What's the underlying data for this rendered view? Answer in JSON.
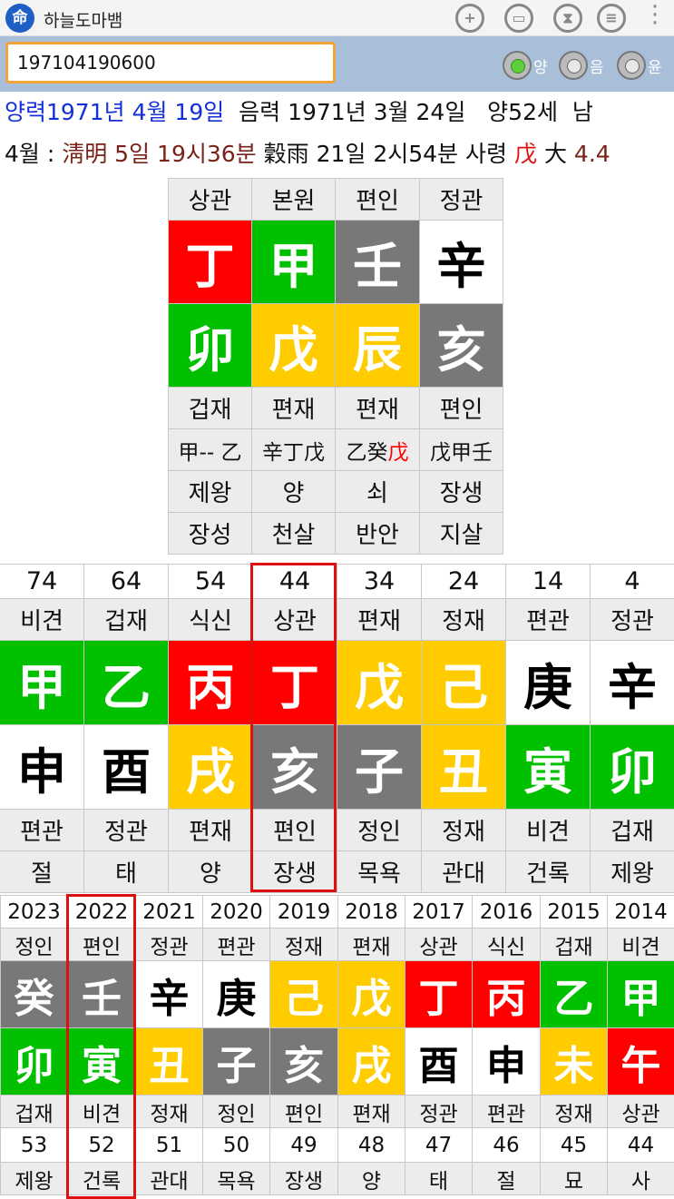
{
  "app": {
    "title": "하늘도마뱀",
    "icon_glyph": "命"
  },
  "toolbar": {
    "icons": [
      "add-person-icon",
      "save-icon",
      "hourglass-icon",
      "database-icon"
    ],
    "menu_icon": "more-vert-icon"
  },
  "input": {
    "value": "197104190600"
  },
  "gender": {
    "options": [
      "양",
      "음",
      "윤"
    ],
    "selected": "양"
  },
  "info": {
    "solar": "양력1971년 4월 19일",
    "lunar": "음력 1971년 3월 24일",
    "age": "양52세",
    "sex": "남",
    "month": "4월 :",
    "term1": "淸明 5일 19시36분",
    "term2": "穀雨 21일 2시54분",
    "saryeong_label": "사령",
    "saryeong_stem": "戊",
    "daeun_label": "大",
    "daeun_value": "4.4"
  },
  "colors": {
    "red": "#ff0000",
    "green": "#00c000",
    "gray": "#787878",
    "yellow": "#ffcc00",
    "white": "#ffffff",
    "highlight": "#e01010"
  },
  "saju": {
    "top_labels": [
      "상관",
      "본원",
      "편인",
      "정관"
    ],
    "stems": [
      {
        "char": "丁",
        "color": "red"
      },
      {
        "char": "甲",
        "color": "green"
      },
      {
        "char": "壬",
        "color": "gray"
      },
      {
        "char": "辛",
        "color": "white"
      }
    ],
    "branches": [
      {
        "char": "卯",
        "color": "green"
      },
      {
        "char": "戊",
        "color": "yellow"
      },
      {
        "char": "辰",
        "color": "yellow"
      },
      {
        "char": "亥",
        "color": "gray"
      }
    ],
    "bottom_labels": [
      "겁재",
      "편재",
      "편재",
      "편인"
    ],
    "hidden_stems": [
      {
        "parts": [
          {
            "t": "甲-- 乙",
            "red": false
          }
        ]
      },
      {
        "parts": [
          {
            "t": "辛丁戊",
            "red": false
          }
        ]
      },
      {
        "parts": [
          {
            "t": "乙癸",
            "red": false
          },
          {
            "t": "戊",
            "red": true
          }
        ]
      },
      {
        "parts": [
          {
            "t": "戊甲壬",
            "red": false
          }
        ]
      }
    ],
    "stage_row1": [
      "제왕",
      "양",
      "쇠",
      "장생"
    ],
    "stage_row2": [
      "장성",
      "천살",
      "반안",
      "지살"
    ]
  },
  "daeun": {
    "ages": [
      "74",
      "64",
      "54",
      "44",
      "34",
      "24",
      "14",
      "4"
    ],
    "top_labels": [
      "비견",
      "겁재",
      "식신",
      "상관",
      "편재",
      "정재",
      "편관",
      "정관"
    ],
    "stems": [
      {
        "char": "甲",
        "color": "green"
      },
      {
        "char": "乙",
        "color": "green"
      },
      {
        "char": "丙",
        "color": "red"
      },
      {
        "char": "丁",
        "color": "red"
      },
      {
        "char": "戊",
        "color": "yellow"
      },
      {
        "char": "己",
        "color": "yellow"
      },
      {
        "char": "庚",
        "color": "white"
      },
      {
        "char": "辛",
        "color": "white"
      }
    ],
    "branches": [
      {
        "char": "申",
        "color": "white"
      },
      {
        "char": "酉",
        "color": "white"
      },
      {
        "char": "戌",
        "color": "yellow"
      },
      {
        "char": "亥",
        "color": "gray"
      },
      {
        "char": "子",
        "color": "gray"
      },
      {
        "char": "丑",
        "color": "yellow"
      },
      {
        "char": "寅",
        "color": "green"
      },
      {
        "char": "卯",
        "color": "green"
      }
    ],
    "bottom_labels": [
      "편관",
      "정관",
      "편재",
      "편인",
      "정인",
      "정재",
      "비견",
      "겁재"
    ],
    "stages": [
      "절",
      "태",
      "양",
      "장생",
      "목욕",
      "관대",
      "건록",
      "제왕"
    ],
    "selected_index": 3
  },
  "seun": {
    "years": [
      "2023",
      "2022",
      "2021",
      "2020",
      "2019",
      "2018",
      "2017",
      "2016",
      "2015",
      "2014"
    ],
    "top_labels": [
      "정인",
      "편인",
      "정관",
      "편관",
      "정재",
      "편재",
      "상관",
      "식신",
      "겁재",
      "비견"
    ],
    "stems": [
      {
        "char": "癸",
        "color": "gray"
      },
      {
        "char": "壬",
        "color": "gray"
      },
      {
        "char": "辛",
        "color": "white"
      },
      {
        "char": "庚",
        "color": "white"
      },
      {
        "char": "己",
        "color": "yellow"
      },
      {
        "char": "戊",
        "color": "yellow"
      },
      {
        "char": "丁",
        "color": "red"
      },
      {
        "char": "丙",
        "color": "red"
      },
      {
        "char": "乙",
        "color": "green"
      },
      {
        "char": "甲",
        "color": "green"
      }
    ],
    "branches": [
      {
        "char": "卯",
        "color": "green"
      },
      {
        "char": "寅",
        "color": "green"
      },
      {
        "char": "丑",
        "color": "yellow"
      },
      {
        "char": "子",
        "color": "gray"
      },
      {
        "char": "亥",
        "color": "gray"
      },
      {
        "char": "戌",
        "color": "yellow"
      },
      {
        "char": "酉",
        "color": "white"
      },
      {
        "char": "申",
        "color": "white"
      },
      {
        "char": "未",
        "color": "yellow"
      },
      {
        "char": "午",
        "color": "red"
      }
    ],
    "bottom_labels": [
      "겁재",
      "비견",
      "정재",
      "정인",
      "편인",
      "편재",
      "정관",
      "편관",
      "정재",
      "상관"
    ],
    "ages": [
      "53",
      "52",
      "51",
      "50",
      "49",
      "48",
      "47",
      "46",
      "45",
      "44"
    ],
    "stages": [
      "제왕",
      "건록",
      "관대",
      "목욕",
      "장생",
      "양",
      "태",
      "절",
      "묘",
      "사"
    ],
    "selected_index": 1
  }
}
